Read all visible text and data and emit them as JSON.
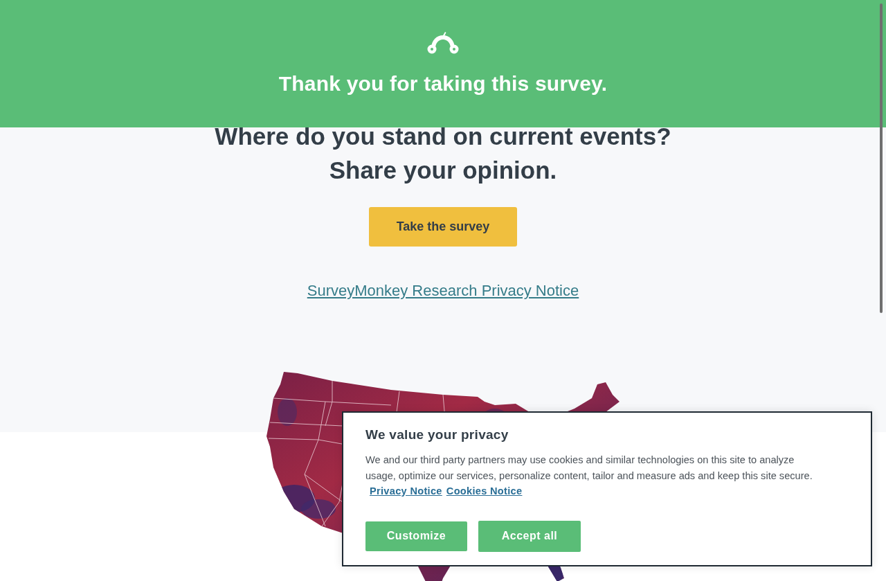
{
  "banner": {
    "title": "Thank you for taking this survey."
  },
  "promo": {
    "heading_lines": [
      "Where do you stand on current events?",
      "Share your opinion."
    ],
    "button": "Take the survey",
    "link": "SurveyMonkey Research Privacy Notice"
  },
  "cookie_dialog": {
    "title": "We value your privacy",
    "text": "We and our third party partners may use cookies and similar technologies on this site to analyze usage, optimize our services, personalize content, tailor and measure ads and keep this site secure.",
    "links": [
      "Privacy Notice",
      "Cookies Notice"
    ],
    "buttons": [
      "Customize",
      "Accept all"
    ]
  }
}
